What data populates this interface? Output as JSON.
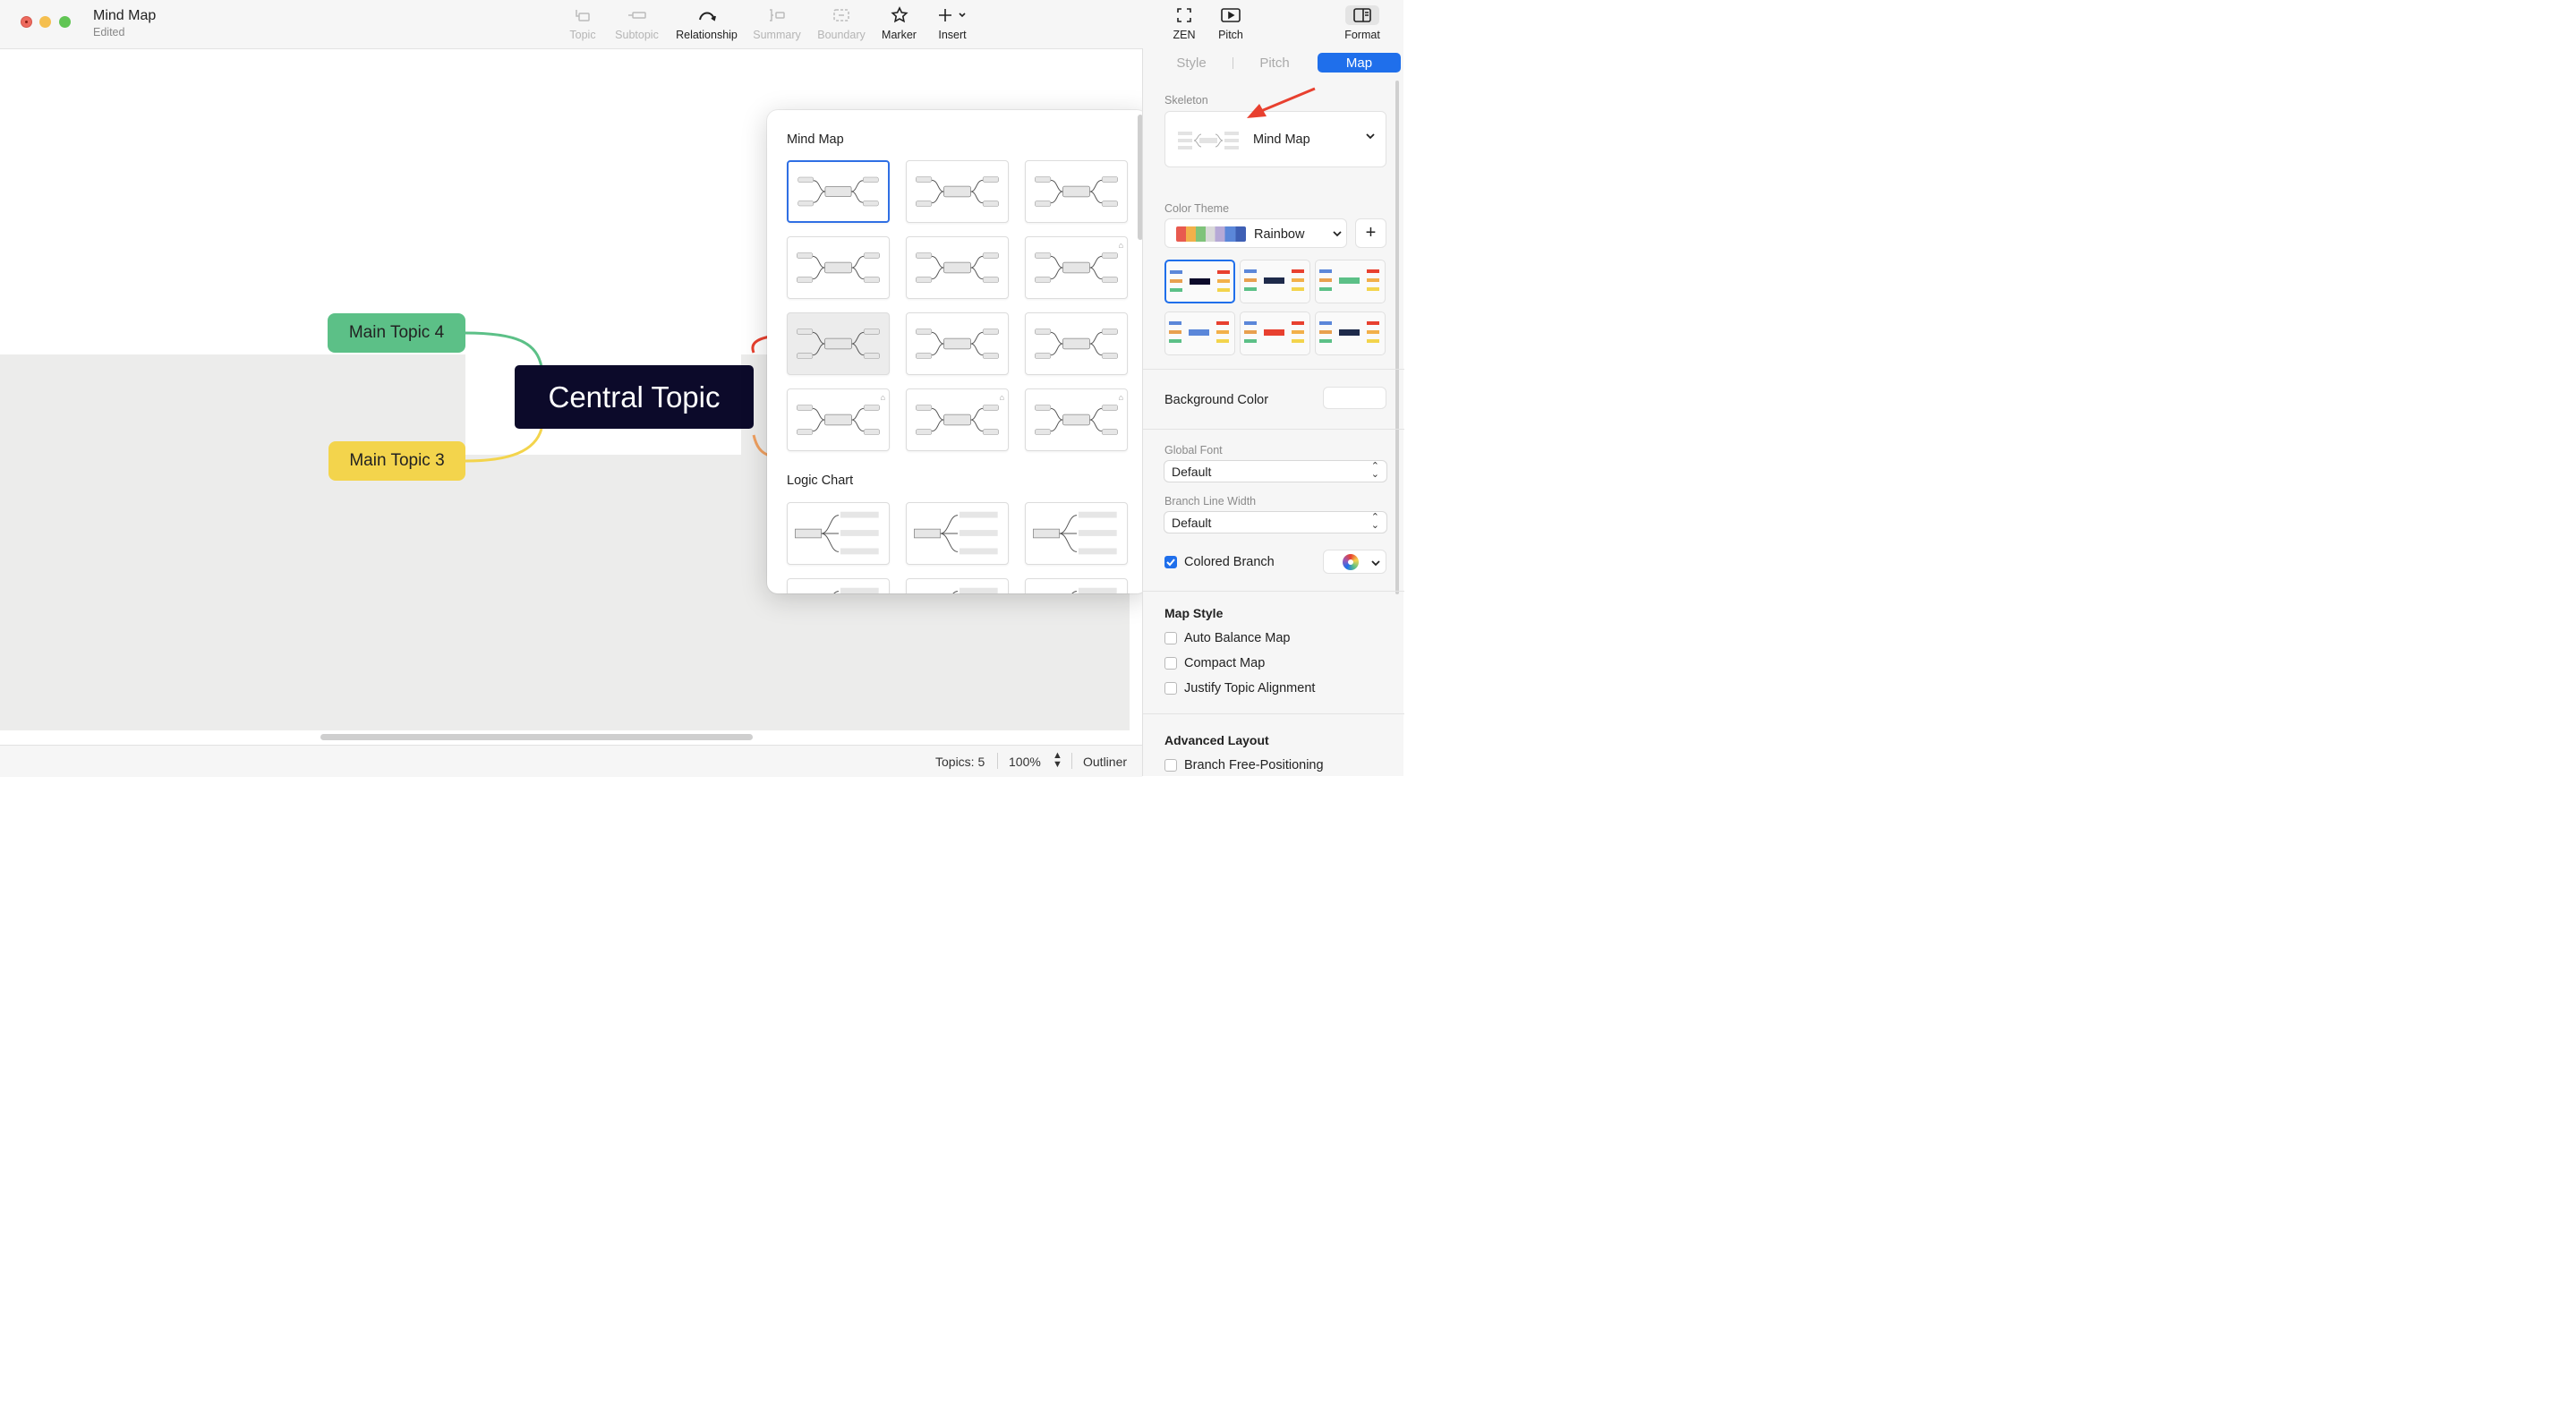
{
  "window": {
    "title": "Mind Map",
    "subtitle": "Edited"
  },
  "toolbar": {
    "topic": "Topic",
    "subtopic": "Subtopic",
    "relationship": "Relationship",
    "summary": "Summary",
    "boundary": "Boundary",
    "marker": "Marker",
    "insert": "Insert",
    "zen": "ZEN",
    "pitch": "Pitch",
    "format": "Format"
  },
  "canvas": {
    "central": "Central Topic",
    "topics": [
      {
        "label": "Main Topic 4",
        "color": "#5cc087"
      },
      {
        "label": "Main Topic 3",
        "color": "#f3d44c"
      }
    ]
  },
  "status": {
    "topics": "Topics: 5",
    "zoom": "100%",
    "outliner": "Outliner"
  },
  "popover": {
    "section1": "Mind Map",
    "section2": "Logic Chart",
    "selected_index": 0
  },
  "panel": {
    "tabs": [
      "Style",
      "Pitch",
      "Map"
    ],
    "active_tab": "Map",
    "skeleton_label": "Skeleton",
    "skeleton_value": "Mind Map",
    "color_theme_label": "Color Theme",
    "color_theme_value": "Rainbow",
    "add_label": "+",
    "background_color_label": "Background Color",
    "global_font_label": "Global Font",
    "global_font_value": "Default",
    "branch_width_label": "Branch Line Width",
    "branch_width_value": "Default",
    "colored_branch": "Colored Branch",
    "map_style": "Map Style",
    "auto_balance": "Auto Balance Map",
    "compact": "Compact Map",
    "justify": "Justify Topic Alignment",
    "advanced": "Advanced Layout",
    "free_positioning": "Branch Free-Positioning"
  },
  "colors": {
    "accent": "#1f6feb",
    "central_bg": "#0c0a2a",
    "arrow": "#e8402f"
  }
}
